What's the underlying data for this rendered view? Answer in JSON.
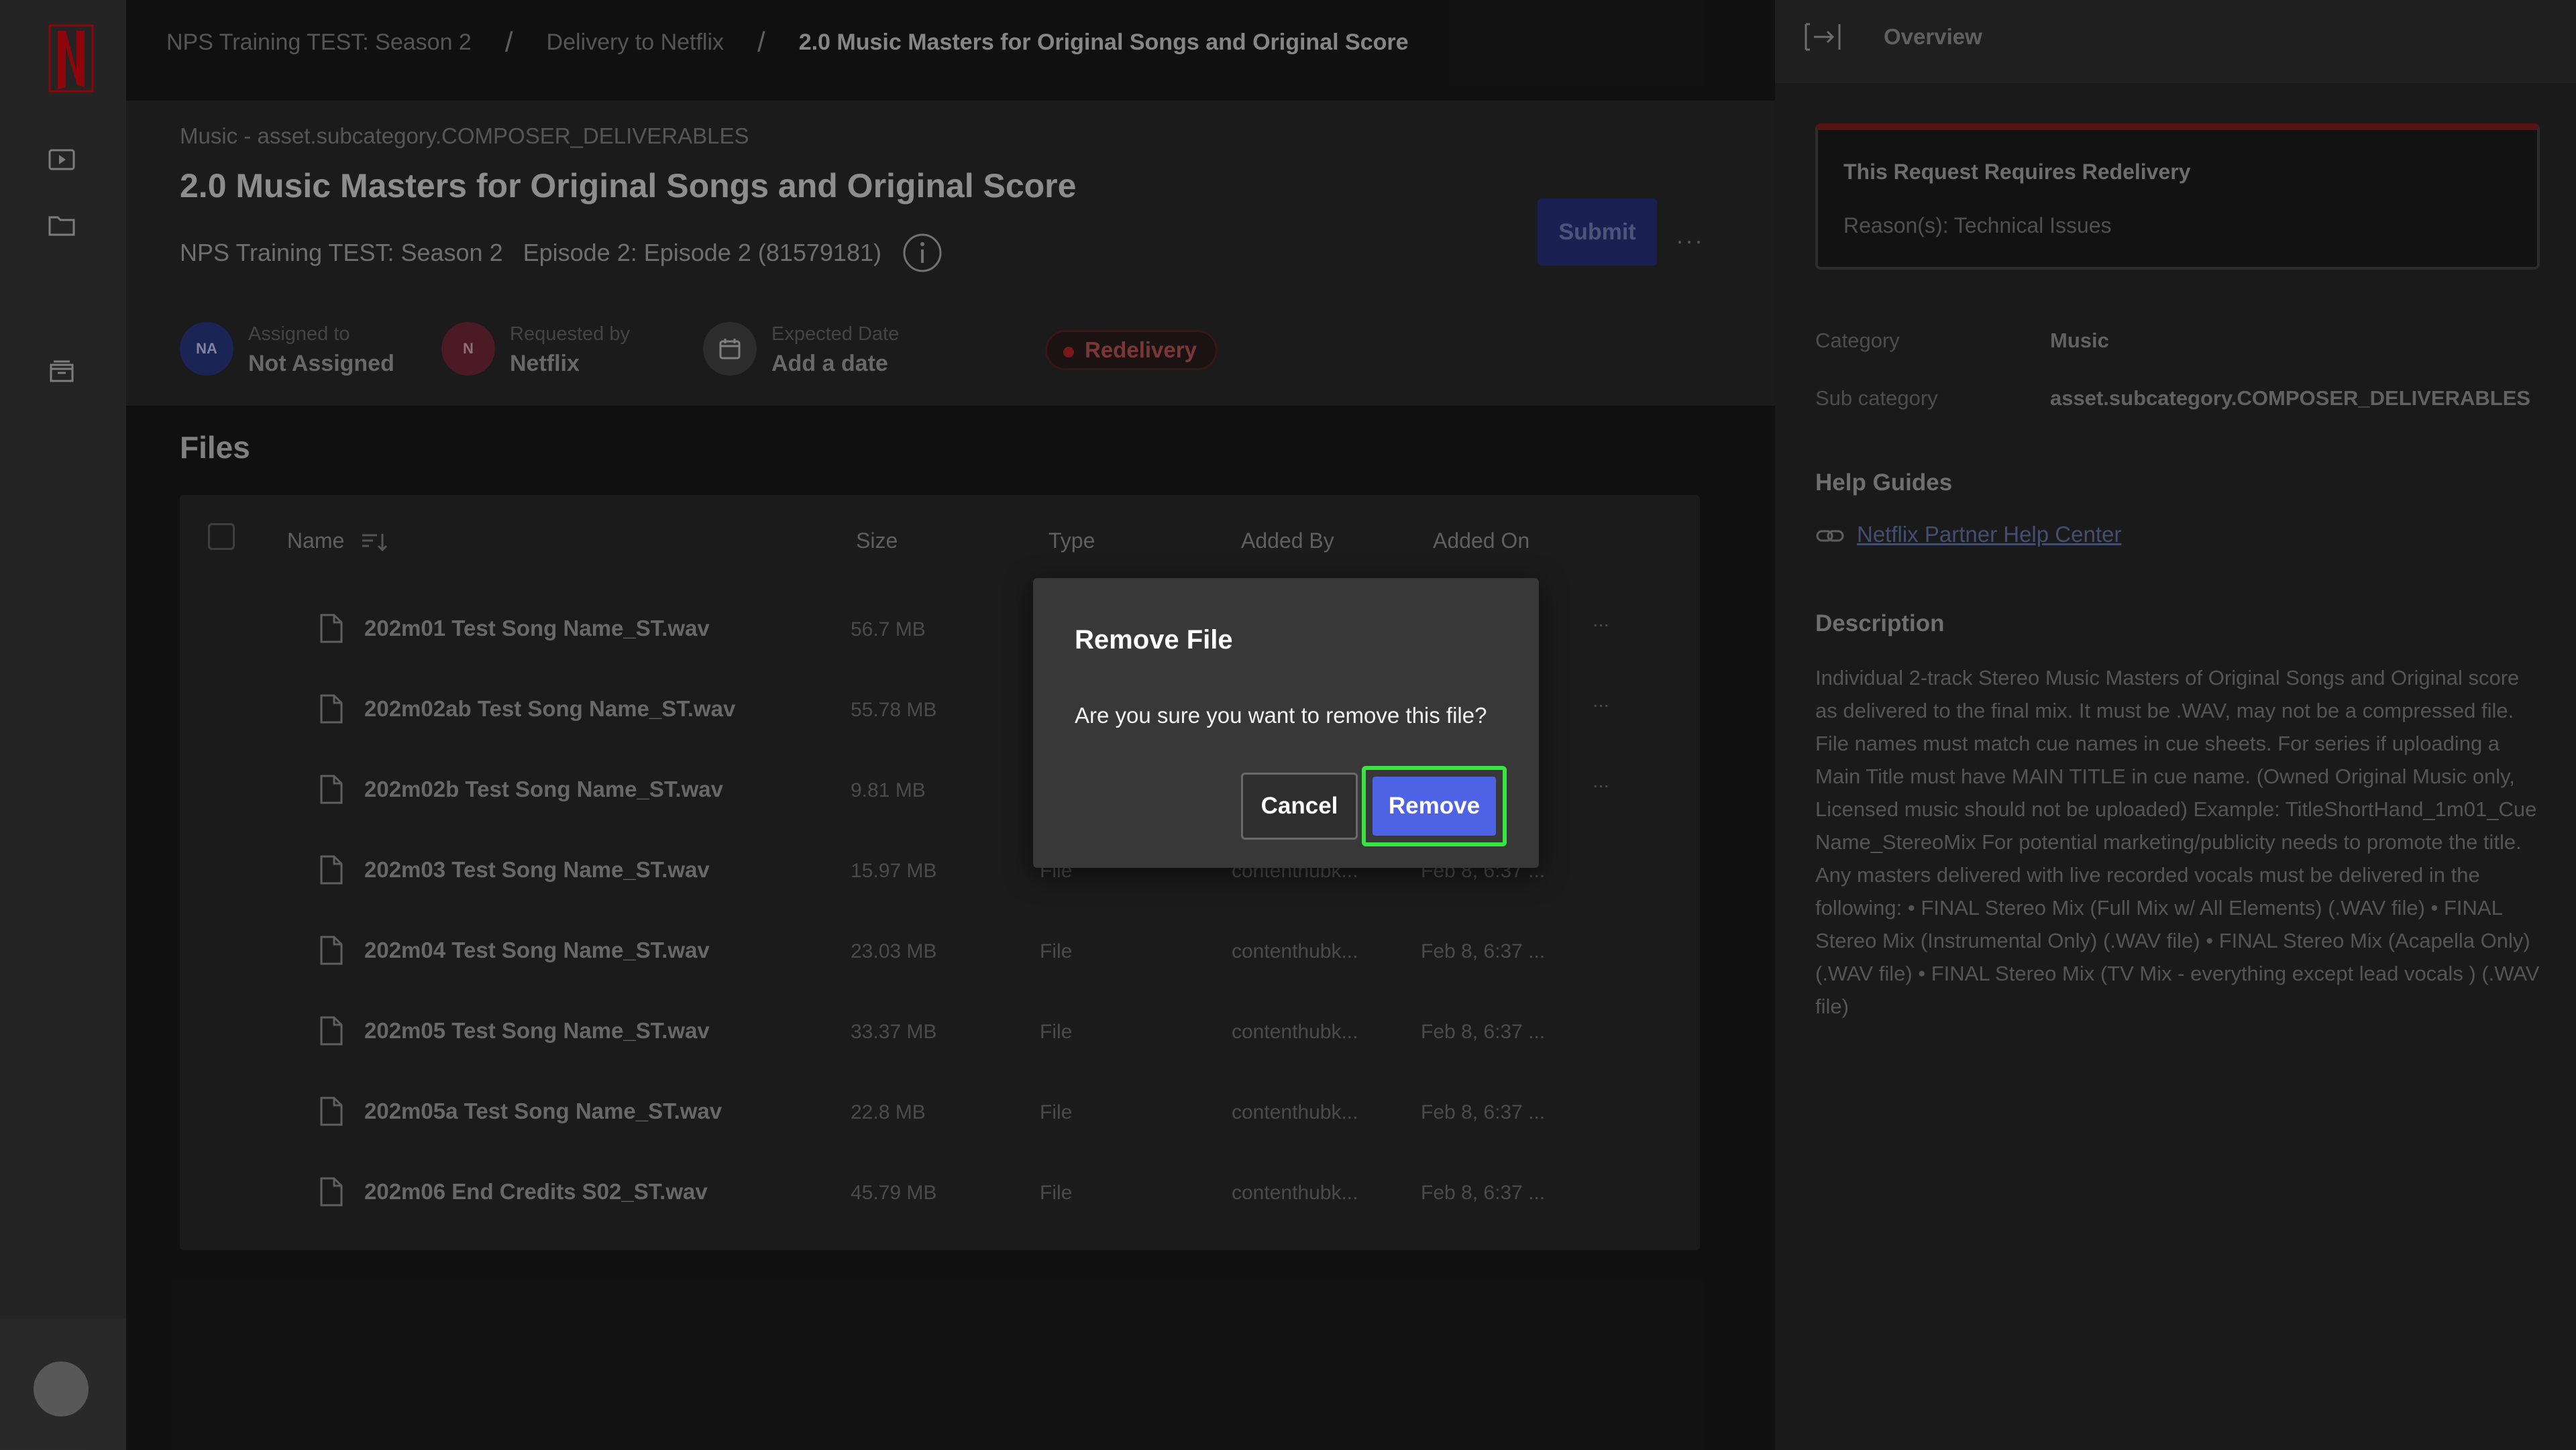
{
  "breadcrumb": [
    "NPS Training TEST: Season 2",
    "Delivery to Netflix",
    "2.0 Music Masters for Original Songs and Original Score"
  ],
  "header": {
    "eyebrow": "Music - asset.subcategory.COMPOSER_DELIVERABLES",
    "title": "2.0 Music Masters for Original Songs and Original Score",
    "season": "NPS Training TEST: Season 2",
    "episode": "Episode 2: Episode 2 (81579181)"
  },
  "meta": {
    "assigned": {
      "initials": "NA",
      "label": "Assigned to",
      "value": "Not Assigned"
    },
    "requested": {
      "initials": "N",
      "label": "Requested by",
      "value": "Netflix"
    },
    "expected": {
      "label": "Expected Date",
      "value": "Add a date"
    },
    "status": "Redelivery",
    "submit_label": "Submit",
    "more_label": "···"
  },
  "files": {
    "title": "Files",
    "columns": {
      "name": "Name",
      "size": "Size",
      "type": "Type",
      "added_by": "Added By",
      "added_on": "Added On"
    },
    "rows": [
      {
        "name": "202m01 Test Song Name_ST.wav",
        "size": "56.7 MB",
        "type": "",
        "added_by": "",
        "added_on": "",
        "more": "..."
      },
      {
        "name": "202m02ab Test Song Name_ST.wav",
        "size": "55.78 MB",
        "type": "",
        "added_by": "",
        "added_on": "",
        "more": "..."
      },
      {
        "name": "202m02b Test Song Name_ST.wav",
        "size": "9.81 MB",
        "type": "",
        "added_by": "",
        "added_on": "",
        "more": "..."
      },
      {
        "name": "202m03 Test Song Name_ST.wav",
        "size": "15.97 MB",
        "type": "File",
        "added_by": "contenthubk...",
        "added_on": "Feb 8, 6:37 ...",
        "more": ""
      },
      {
        "name": "202m04 Test Song Name_ST.wav",
        "size": "23.03 MB",
        "type": "File",
        "added_by": "contenthubk...",
        "added_on": "Feb 8, 6:37 ...",
        "more": ""
      },
      {
        "name": "202m05 Test Song Name_ST.wav",
        "size": "33.37 MB",
        "type": "File",
        "added_by": "contenthubk...",
        "added_on": "Feb 8, 6:37 ...",
        "more": ""
      },
      {
        "name": "202m05a Test Song Name_ST.wav",
        "size": "22.8 MB",
        "type": "File",
        "added_by": "contenthubk...",
        "added_on": "Feb 8, 6:37 ...",
        "more": ""
      },
      {
        "name": "202m06 End Credits S02_ST.wav",
        "size": "45.79 MB",
        "type": "File",
        "added_by": "contenthubk...",
        "added_on": "Feb 8, 6:37 ...",
        "more": ""
      }
    ]
  },
  "panel": {
    "title": "Overview",
    "alert_title": "This Request Requires Redelivery",
    "alert_reason": "Reason(s): Technical Issues",
    "category_label": "Category",
    "category_value": "Music",
    "subcategory_label": "Sub category",
    "subcategory_value": "asset.subcategory.COMPOSER_DELIVERABLES",
    "help_title": "Help Guides",
    "help_link": "Netflix Partner Help Center",
    "description_title": "Description",
    "description": "Individual 2-track Stereo Music Masters of Original Songs and Original score as delivered to the final mix. It must be .WAV, may not be a compressed file. File names must match cue names in cue sheets. For series if uploading a Main Title must have MAIN TITLE in cue name. (Owned Original Music only, Licensed music should not be uploaded) Example: TitleShortHand_1m01_Cue Name_StereoMix For potential marketing/publicity needs to promote the title. Any masters delivered with live recorded vocals must be delivered in the following: • FINAL Stereo Mix (Full Mix w/ All Elements) (.WAV file) • FINAL Stereo Mix (Instrumental Only) (.WAV file) • FINAL Stereo Mix (Acapella Only) (.WAV file) • FINAL Stereo Mix (TV Mix - everything except lead vocals ) (.WAV file)"
  },
  "dialog": {
    "title": "Remove File",
    "message": "Are you sure you want to remove this file?",
    "cancel_label": "Cancel",
    "remove_label": "Remove"
  },
  "colors": {
    "brand_red": "#e50914",
    "primary_blue": "#4d62e4",
    "highlight_green": "#39e342"
  },
  "icons": [
    "netflix-logo",
    "play-icon",
    "folder-icon",
    "inbox-icon",
    "info-icon",
    "calendar-icon",
    "sort-icon",
    "file-icon",
    "collapse-panel-icon",
    "link-icon"
  ]
}
